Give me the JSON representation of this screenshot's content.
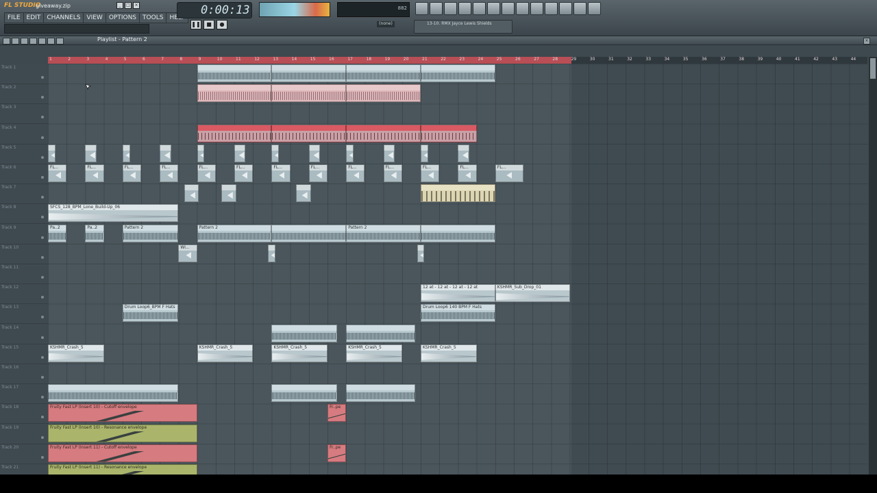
{
  "app": {
    "logo": "FL STUDIO",
    "filename": "giveaway.zip",
    "menu": [
      "FILE",
      "EDIT",
      "CHANNELS",
      "VIEW",
      "OPTIONS",
      "TOOLS",
      "HELP"
    ]
  },
  "transport": {
    "time": "0:00:13",
    "cpu_value": "882",
    "snap": "(none)",
    "song_title": "13-10. RMX Jayce Lewis Shields"
  },
  "playlist": {
    "title": "Playlist - Pattern 2",
    "bars": [
      1,
      2,
      3,
      4,
      5,
      6,
      7,
      8,
      9,
      10,
      11,
      12,
      13,
      14,
      15,
      16,
      17,
      18,
      19,
      20,
      21,
      22,
      23,
      24,
      25,
      26,
      27,
      28,
      29,
      30,
      31,
      32,
      33,
      34,
      35,
      36,
      37,
      38,
      39,
      40,
      41,
      42,
      43,
      44
    ],
    "tracks": [
      "Track 1",
      "Track 2",
      "Track 3",
      "Track 4",
      "Track 5",
      "Track 6",
      "Track 7",
      "Track 8",
      "Track 9",
      "Track 10",
      "Track 11",
      "Track 12",
      "Track 13",
      "Track 14",
      "Track 15",
      "Track 16",
      "Track 17",
      "Track 18",
      "Track 19",
      "Track 20",
      "Track 21"
    ],
    "clips": [
      {
        "track": 0,
        "start": 9,
        "len": 4,
        "style": "teal",
        "label": ""
      },
      {
        "track": 0,
        "start": 13,
        "len": 4,
        "style": "teal",
        "label": ""
      },
      {
        "track": 0,
        "start": 17,
        "len": 4,
        "style": "teal",
        "label": ""
      },
      {
        "track": 0,
        "start": 21,
        "len": 4,
        "style": "teal",
        "label": ""
      },
      {
        "track": 1,
        "start": 9,
        "len": 4,
        "style": "pink",
        "label": ""
      },
      {
        "track": 1,
        "start": 13,
        "len": 4,
        "style": "pink",
        "label": ""
      },
      {
        "track": 1,
        "start": 17,
        "len": 4,
        "style": "pink",
        "label": ""
      },
      {
        "track": 3,
        "start": 9,
        "len": 4,
        "style": "red",
        "label": ""
      },
      {
        "track": 3,
        "start": 13,
        "len": 4,
        "style": "red",
        "label": ""
      },
      {
        "track": 3,
        "start": 17,
        "len": 4,
        "style": "red",
        "label": ""
      },
      {
        "track": 3,
        "start": 21,
        "len": 3,
        "style": "red",
        "label": ""
      },
      {
        "track": 4,
        "start": 1,
        "len": 0.4,
        "style": "hit",
        "label": ""
      },
      {
        "track": 4,
        "start": 3,
        "len": 0.6,
        "style": "hit",
        "label": ""
      },
      {
        "track": 4,
        "start": 5,
        "len": 0.4,
        "style": "hit",
        "label": ""
      },
      {
        "track": 4,
        "start": 7,
        "len": 0.6,
        "style": "hit",
        "label": ""
      },
      {
        "track": 4,
        "start": 9,
        "len": 0.4,
        "style": "hit",
        "label": ""
      },
      {
        "track": 4,
        "start": 11,
        "len": 0.6,
        "style": "hit",
        "label": ""
      },
      {
        "track": 4,
        "start": 13,
        "len": 0.4,
        "style": "hit",
        "label": ""
      },
      {
        "track": 4,
        "start": 15,
        "len": 0.6,
        "style": "hit",
        "label": ""
      },
      {
        "track": 4,
        "start": 17,
        "len": 0.4,
        "style": "hit",
        "label": ""
      },
      {
        "track": 4,
        "start": 19,
        "len": 0.6,
        "style": "hit",
        "label": ""
      },
      {
        "track": 4,
        "start": 21,
        "len": 0.4,
        "style": "hit",
        "label": ""
      },
      {
        "track": 4,
        "start": 23,
        "len": 0.6,
        "style": "hit",
        "label": ""
      },
      {
        "track": 5,
        "start": 1,
        "len": 1,
        "style": "hit",
        "label": "FL..."
      },
      {
        "track": 5,
        "start": 3,
        "len": 1,
        "style": "hit",
        "label": "FL..."
      },
      {
        "track": 5,
        "start": 5,
        "len": 1,
        "style": "hit",
        "label": "FL..."
      },
      {
        "track": 5,
        "start": 7,
        "len": 1,
        "style": "hit",
        "label": "FL..."
      },
      {
        "track": 5,
        "start": 9,
        "len": 1,
        "style": "hit",
        "label": "FL..."
      },
      {
        "track": 5,
        "start": 11,
        "len": 1,
        "style": "hit",
        "label": "FL..."
      },
      {
        "track": 5,
        "start": 13,
        "len": 1,
        "style": "hit",
        "label": "FL..."
      },
      {
        "track": 5,
        "start": 15,
        "len": 1,
        "style": "hit",
        "label": "FL..."
      },
      {
        "track": 5,
        "start": 17,
        "len": 1,
        "style": "hit",
        "label": "FL..."
      },
      {
        "track": 5,
        "start": 19,
        "len": 1,
        "style": "hit",
        "label": "FL..."
      },
      {
        "track": 5,
        "start": 21,
        "len": 1,
        "style": "hit",
        "label": "FL..."
      },
      {
        "track": 5,
        "start": 23,
        "len": 1,
        "style": "hit",
        "label": "FL..."
      },
      {
        "track": 5,
        "start": 25,
        "len": 1.5,
        "style": "hit",
        "label": "FL..."
      },
      {
        "track": 6,
        "start": 8.3,
        "len": 0.8,
        "style": "hit",
        "label": ""
      },
      {
        "track": 6,
        "start": 10.3,
        "len": 0.8,
        "style": "hit",
        "label": ""
      },
      {
        "track": 6,
        "start": 14.3,
        "len": 0.8,
        "style": "hit",
        "label": ""
      },
      {
        "track": 6,
        "start": 21,
        "len": 4,
        "style": "cream",
        "label": ""
      },
      {
        "track": 7,
        "start": 1,
        "len": 7,
        "style": "wave",
        "label": "SFCS_128_BPM_Lone_Build-Up_06"
      },
      {
        "track": 8,
        "start": 1,
        "len": 1,
        "style": "teal",
        "label": "Pa..2"
      },
      {
        "track": 8,
        "start": 3,
        "len": 1,
        "style": "teal",
        "label": "Pa..2"
      },
      {
        "track": 8,
        "start": 5,
        "len": 3,
        "style": "teal",
        "label": "Pattern 2"
      },
      {
        "track": 8,
        "start": 9,
        "len": 4,
        "style": "teal",
        "label": "Pattern 2"
      },
      {
        "track": 8,
        "start": 13,
        "len": 4,
        "style": "teal",
        "label": ""
      },
      {
        "track": 8,
        "start": 17,
        "len": 4,
        "style": "teal",
        "label": "Pattern 2"
      },
      {
        "track": 8,
        "start": 21,
        "len": 4,
        "style": "teal",
        "label": ""
      },
      {
        "track": 9,
        "start": 8,
        "len": 1,
        "style": "hit",
        "label": "Wi..."
      },
      {
        "track": 9,
        "start": 12.8,
        "len": 0.4,
        "style": "hit",
        "label": ""
      },
      {
        "track": 9,
        "start": 20.8,
        "len": 0.4,
        "style": "hit",
        "label": ""
      },
      {
        "track": 11,
        "start": 21,
        "len": 4,
        "style": "wave",
        "label": "12 at - 12 at - 12 at - 12 at"
      },
      {
        "track": 11,
        "start": 25,
        "len": 4,
        "style": "wave",
        "label": "KSHMR_Sub_Drop_01"
      },
      {
        "track": 12,
        "start": 5,
        "len": 3,
        "style": "teal",
        "label": "Drum Loop6_BPM F Hats"
      },
      {
        "track": 12,
        "start": 21,
        "len": 4,
        "style": "teal",
        "label": "Drum Loop6 140 BPM F Hats"
      },
      {
        "track": 13,
        "start": 13,
        "len": 3.5,
        "style": "teal",
        "label": ""
      },
      {
        "track": 13,
        "start": 17,
        "len": 3.7,
        "style": "teal",
        "label": ""
      },
      {
        "track": 14,
        "start": 1,
        "len": 3,
        "style": "wave",
        "label": "KSHMR_Crash_5"
      },
      {
        "track": 14,
        "start": 9,
        "len": 3,
        "style": "wave",
        "label": "KSHMR_Crash_5"
      },
      {
        "track": 14,
        "start": 13,
        "len": 3,
        "style": "wave",
        "label": "KSHMR_Crash_5"
      },
      {
        "track": 14,
        "start": 17,
        "len": 3,
        "style": "wave",
        "label": "KSHMR_Crash_5"
      },
      {
        "track": 14,
        "start": 21,
        "len": 3,
        "style": "wave",
        "label": "KSHMR_Crash_5"
      },
      {
        "track": 16,
        "start": 1,
        "len": 7,
        "style": "teal",
        "label": ""
      },
      {
        "track": 16,
        "start": 13,
        "len": 3.5,
        "style": "teal",
        "label": ""
      },
      {
        "track": 16,
        "start": 17,
        "len": 3.7,
        "style": "teal",
        "label": ""
      },
      {
        "track": 17,
        "start": 1,
        "len": 8,
        "style": "env-red",
        "label": "Fruity Fast LP (Insert 10) - Cutoff envelope"
      },
      {
        "track": 17,
        "start": 16,
        "len": 1,
        "style": "env-red",
        "label": "Fr..pe"
      },
      {
        "track": 18,
        "start": 1,
        "len": 8,
        "style": "env-olive",
        "label": "Fruity Fast LP (Insert 10) - Resonance envelope"
      },
      {
        "track": 19,
        "start": 1,
        "len": 8,
        "style": "env-red",
        "label": "Fruity Fast LP (Insert 11) - Cutoff envelope"
      },
      {
        "track": 19,
        "start": 16,
        "len": 1,
        "style": "env-red",
        "label": "Fr..pe"
      },
      {
        "track": 20,
        "start": 1,
        "len": 8,
        "style": "env-olive",
        "label": "Fruity Fast LP (Insert 11) - Resonance envelope"
      }
    ]
  }
}
